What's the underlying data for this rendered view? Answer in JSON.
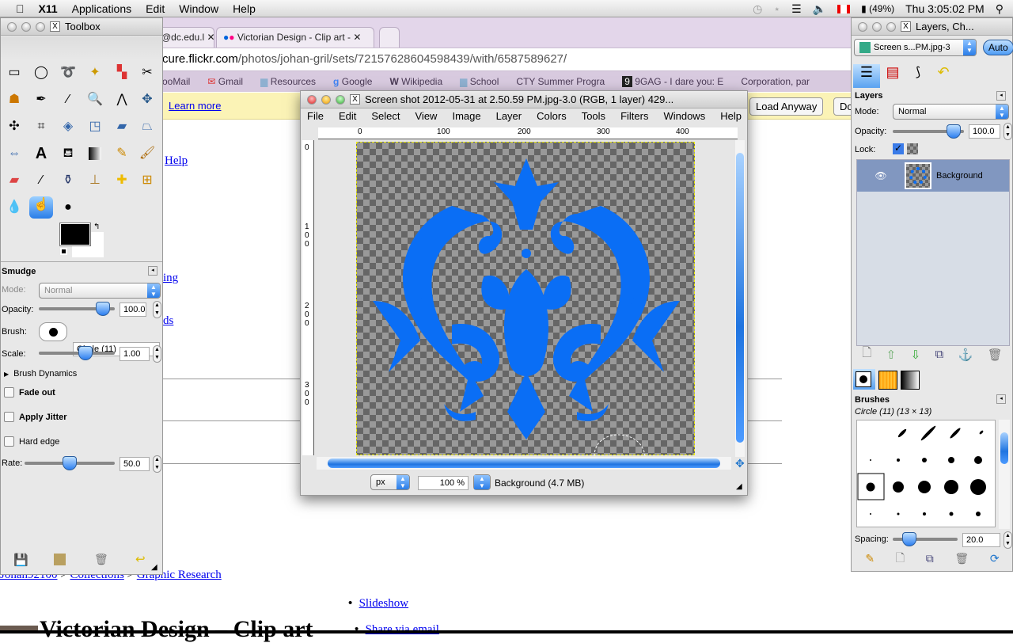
{
  "menubar": {
    "app": "X11",
    "items": [
      "Applications",
      "Edit",
      "Window",
      "Help"
    ],
    "battery": "(49%)",
    "clock": "Thu 3:05:02 PM"
  },
  "browser": {
    "tabs": [
      {
        "label": "@dc.edu.l"
      },
      {
        "label": "Victorian Design - Clip art -"
      }
    ],
    "url_host": "cure.flickr.com",
    "url_path": "/photos/johan-gril/sets/72157628604598439/with/6587589627/",
    "bookmarks": [
      "ooMail",
      "Gmail",
      "Resources",
      "Google",
      "Wikipedia",
      "School",
      "CTY Summer Progra",
      "9GAG - I dare you: E",
      "Corporation, par"
    ],
    "infobar": {
      "learn_more": "Learn more",
      "load_anyway": "Load Anyway",
      "other": "Do"
    },
    "page": {
      "links": [
        "Help",
        "ing",
        "ds"
      ],
      "breadcrumb": [
        "Johan92100",
        "Collections",
        "Graphic Research"
      ],
      "sep": ">",
      "list": [
        "Slideshow",
        "Share via email"
      ],
      "heading": "Victorian Design – Clip art"
    }
  },
  "toolbox": {
    "title": "Toolbox",
    "tool_options": {
      "title": "Smudge",
      "mode_label": "Mode:",
      "mode": "Normal",
      "opacity_label": "Opacity:",
      "opacity": "100.0",
      "opacity_pct": 100,
      "brush_label": "Brush:",
      "brush": "Circle (11)",
      "scale_label": "Scale:",
      "scale": "1.00",
      "scale_pct": 55,
      "brush_dynamics": "Brush Dynamics",
      "fade_out": "Fade out",
      "apply_jitter": "Apply Jitter",
      "hard_edge": "Hard edge",
      "rate_label": "Rate:",
      "rate": "50.0",
      "rate_pct": 50
    }
  },
  "image_window": {
    "title": "Screen shot 2012-05-31 at 2.50.59 PM.jpg-3.0 (RGB, 1 layer) 429...",
    "menu": [
      "File",
      "Edit",
      "Select",
      "View",
      "Image",
      "Layer",
      "Colors",
      "Tools",
      "Filters",
      "Windows",
      "Help"
    ],
    "ruler_h": [
      "0",
      "100",
      "200",
      "300",
      "400"
    ],
    "ruler_v": [
      "0",
      "1\n0\n0",
      "2\n0\n0",
      "3\n0\n0"
    ],
    "unit": "px",
    "zoom": "100 %",
    "status": "Background (4.7 MB)",
    "accent": "#0a6ef5"
  },
  "layers_dock": {
    "title": "Layers, Ch...",
    "image_select": "Screen s...PM.jpg-3",
    "auto": "Auto",
    "layers": {
      "title": "Layers",
      "mode_label": "Mode:",
      "mode": "Normal",
      "opacity_label": "Opacity:",
      "opacity": "100.0",
      "lock_label": "Lock:",
      "items": [
        {
          "name": "Background",
          "visible": true
        }
      ]
    },
    "brushes": {
      "title": "Brushes",
      "selected": "Circle (11) (13 × 13)",
      "spacing_label": "Spacing:",
      "spacing": "20.0",
      "spacing_pct": 10
    }
  }
}
